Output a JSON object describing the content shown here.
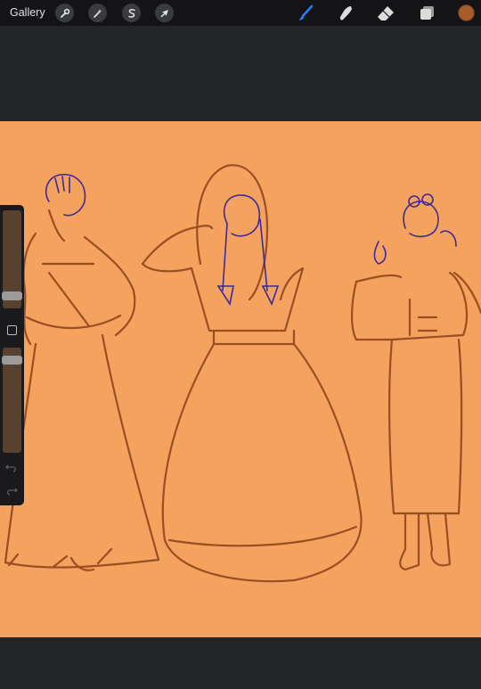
{
  "topbar": {
    "gallery_label": "Gallery",
    "left_tools": [
      {
        "name": "actions",
        "icon": "wrench-icon"
      },
      {
        "name": "adjustments",
        "icon": "magic-wand-icon"
      },
      {
        "name": "selection",
        "icon": "selection-s-icon"
      },
      {
        "name": "transform",
        "icon": "arrow-cursor-icon"
      }
    ],
    "right_tools": [
      {
        "name": "brush",
        "icon": "brush-icon",
        "active": true,
        "color": "#2d7cf6"
      },
      {
        "name": "smudge",
        "icon": "smudge-finger-icon",
        "active": false
      },
      {
        "name": "eraser",
        "icon": "eraser-icon",
        "active": false
      },
      {
        "name": "layers",
        "icon": "layers-icon",
        "active": false
      }
    ],
    "current_color": "#a55b2a"
  },
  "canvas": {
    "background": "#f4a25d",
    "sketch_color": "#9a4e22",
    "ink_color": "#3a2a9a"
  },
  "sidebar": {
    "brush_size_level": 0.2,
    "opacity_level": 0.13,
    "modifier_icon": "square-modifier-icon",
    "undo_icon": "undo-icon",
    "redo_icon": "redo-icon"
  }
}
